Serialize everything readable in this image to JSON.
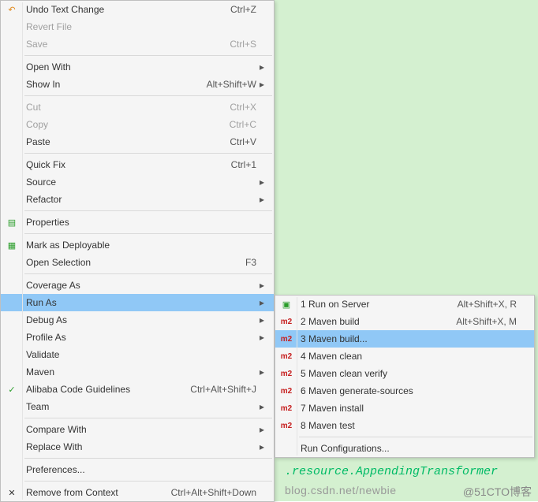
{
  "background": {
    "code_fragment": ".resource.AppendingTransformer",
    "url_fragment": "blog.csdn.net/newbie",
    "watermark": "@51CTO博客"
  },
  "main_menu": [
    {
      "type": "item",
      "icon": "undo-icon",
      "icon_glyph": "↶",
      "icon_cls": "ico-orange",
      "label": "Undo Text Change",
      "shortcut": "Ctrl+Z"
    },
    {
      "type": "item",
      "label": "Revert File",
      "disabled": true
    },
    {
      "type": "item",
      "label": "Save",
      "disabled": true,
      "shortcut": "Ctrl+S"
    },
    {
      "type": "sep"
    },
    {
      "type": "item",
      "label": "Open With",
      "submenu": true
    },
    {
      "type": "item",
      "label": "Show In",
      "shortcut": "Alt+Shift+W",
      "submenu": true
    },
    {
      "type": "sep"
    },
    {
      "type": "item",
      "label": "Cut",
      "disabled": true,
      "shortcut": "Ctrl+X"
    },
    {
      "type": "item",
      "label": "Copy",
      "disabled": true,
      "shortcut": "Ctrl+C"
    },
    {
      "type": "item",
      "label": "Paste",
      "shortcut": "Ctrl+V"
    },
    {
      "type": "sep"
    },
    {
      "type": "item",
      "label": "Quick Fix",
      "shortcut": "Ctrl+1"
    },
    {
      "type": "item",
      "label": "Source",
      "submenu": true
    },
    {
      "type": "item",
      "label": "Refactor",
      "submenu": true
    },
    {
      "type": "sep"
    },
    {
      "type": "item",
      "icon": "properties-icon",
      "icon_glyph": "▤",
      "icon_cls": "ico-green",
      "label": "Properties"
    },
    {
      "type": "sep"
    },
    {
      "type": "item",
      "icon": "deploy-icon",
      "icon_glyph": "▦",
      "icon_cls": "ico-green",
      "label": "Mark as Deployable"
    },
    {
      "type": "item",
      "label": "Open Selection",
      "shortcut": "F3"
    },
    {
      "type": "sep"
    },
    {
      "type": "item",
      "label": "Coverage As",
      "submenu": true
    },
    {
      "type": "item",
      "label": "Run As",
      "submenu": true,
      "highlight": true
    },
    {
      "type": "item",
      "label": "Debug As",
      "submenu": true
    },
    {
      "type": "item",
      "label": "Profile As",
      "submenu": true
    },
    {
      "type": "item",
      "label": "Validate"
    },
    {
      "type": "item",
      "label": "Maven",
      "submenu": true
    },
    {
      "type": "item",
      "icon": "alibaba-icon",
      "icon_glyph": "✓",
      "icon_cls": "ico-green",
      "label": "Alibaba Code Guidelines",
      "shortcut": "Ctrl+Alt+Shift+J"
    },
    {
      "type": "item",
      "label": "Team",
      "submenu": true
    },
    {
      "type": "sep"
    },
    {
      "type": "item",
      "label": "Compare With",
      "submenu": true
    },
    {
      "type": "item",
      "label": "Replace With",
      "submenu": true
    },
    {
      "type": "sep"
    },
    {
      "type": "item",
      "label": "Preferences..."
    },
    {
      "type": "sep"
    },
    {
      "type": "item",
      "icon": "remove-icon",
      "icon_glyph": "✕",
      "label": "Remove from Context",
      "shortcut": "Ctrl+Alt+Shift+Down"
    }
  ],
  "sub_menu": [
    {
      "type": "item",
      "icon": "server-icon",
      "icon_glyph": "▣",
      "icon_cls": "ico-green",
      "label": "1  Run on Server",
      "shortcut": "Alt+Shift+X, R"
    },
    {
      "type": "item",
      "icon": "m2-icon",
      "icon_glyph": "m2",
      "icon_cls": "m2",
      "label": "2  Maven build",
      "shortcut": "Alt+Shift+X, M"
    },
    {
      "type": "item",
      "icon": "m2-icon",
      "icon_glyph": "m2",
      "icon_cls": "m2",
      "label": "3  Maven build...",
      "highlight": true
    },
    {
      "type": "item",
      "icon": "m2-icon",
      "icon_glyph": "m2",
      "icon_cls": "m2",
      "label": "4  Maven clean"
    },
    {
      "type": "item",
      "icon": "m2-icon",
      "icon_glyph": "m2",
      "icon_cls": "m2",
      "label": "5  Maven clean verify"
    },
    {
      "type": "item",
      "icon": "m2-icon",
      "icon_glyph": "m2",
      "icon_cls": "m2",
      "label": "6  Maven generate-sources"
    },
    {
      "type": "item",
      "icon": "m2-icon",
      "icon_glyph": "m2",
      "icon_cls": "m2",
      "label": "7  Maven install"
    },
    {
      "type": "item",
      "icon": "m2-icon",
      "icon_glyph": "m2",
      "icon_cls": "m2",
      "label": "8  Maven test"
    },
    {
      "type": "sep"
    },
    {
      "type": "item",
      "label": "Run Configurations..."
    }
  ]
}
